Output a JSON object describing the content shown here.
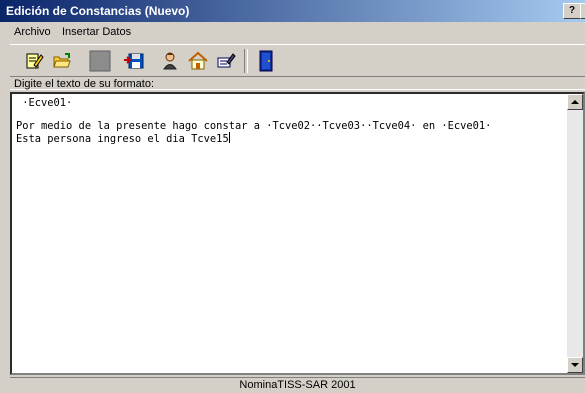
{
  "window": {
    "title": "Edición de Constancias (Nuevo)",
    "help_label": "?",
    "close_label": "×"
  },
  "menu": [
    {
      "label": "Archivo"
    },
    {
      "label": "Insertar Datos"
    }
  ],
  "toolbar": {
    "icons": [
      "edit-document-icon",
      "open-folder-icon",
      "blank-button-icon",
      "save-disk-icon",
      "user-icon",
      "home-icon",
      "edit-field-icon",
      "exit-door-icon"
    ]
  },
  "prompt": {
    "label": "Digite el texto de su formato:"
  },
  "editor": {
    "line1": " ·Ecve01·",
    "line2": "",
    "line3": "Por medio de la presente hago constar a ·Tcve02··Tcve03··Tcve04· en ·Ecve01·",
    "line4": "Esta persona ingreso el dia Tcve15"
  },
  "status": {
    "text": "NominaTISS-SAR 2001"
  },
  "colors": {
    "titlebar_start": "#0a246a",
    "titlebar_end": "#a6caf0",
    "chrome": "#d4d0c8"
  }
}
